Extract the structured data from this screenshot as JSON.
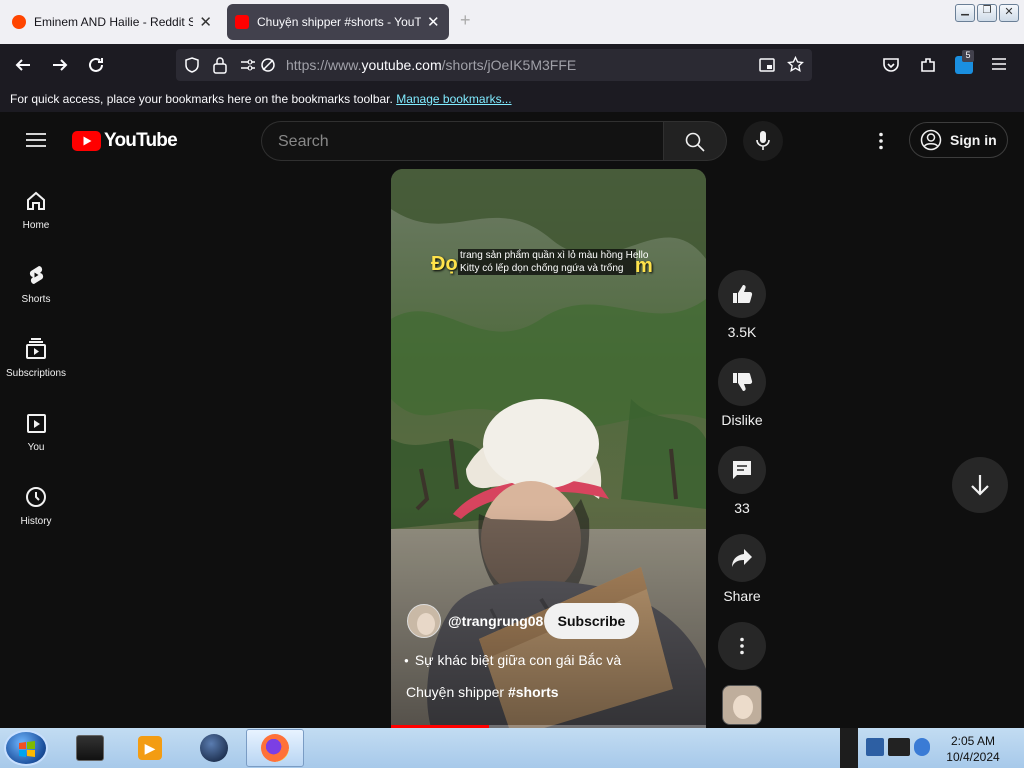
{
  "browser": {
    "tabs": [
      {
        "title": "Eminem AND Hailie - Reddit Se"
      },
      {
        "title": "Chuyện shipper #shorts - YouTu"
      }
    ],
    "new_tab": "+",
    "url": {
      "prefix": "https://www.",
      "domain": "youtube.com",
      "path": "/shorts/jOeIK5M3FFE"
    },
    "extension_badge": "5",
    "bookmarks_msg": "For quick access, place your bookmarks here on the bookmarks toolbar.",
    "bookmarks_link": "Manage bookmarks..."
  },
  "youtube": {
    "logo": "YouTube",
    "search_placeholder": "Search",
    "sign_in": "Sign in",
    "sidebar": [
      "Home",
      "Shorts",
      "Subscriptions",
      "You",
      "History"
    ],
    "video": {
      "caption_big_left": "Đọ",
      "caption_big_right": "m",
      "caption_line1": "trang sản phẩm quần xì lỏ màu hồng Hello",
      "caption_line2": "Kitty có lếp dọn chống ngứa và trống",
      "channel": "@trangrung08",
      "subscribe": "Subscribe",
      "title_line1": "Sự khác biệt giữa con gái Bắc và",
      "title_line2": "Chuyện shipper ",
      "title_tag": "#shorts",
      "progress": 0.31
    },
    "actions": {
      "likes": "3.5K",
      "dislike": "Dislike",
      "comments": "33",
      "share": "Share"
    }
  },
  "taskbar": {
    "time": "2:05 AM",
    "date": "10/4/2024"
  },
  "colors": {
    "yt_red": "#ff0000",
    "bg": "#0f0f0f",
    "link": "#80ebff"
  }
}
